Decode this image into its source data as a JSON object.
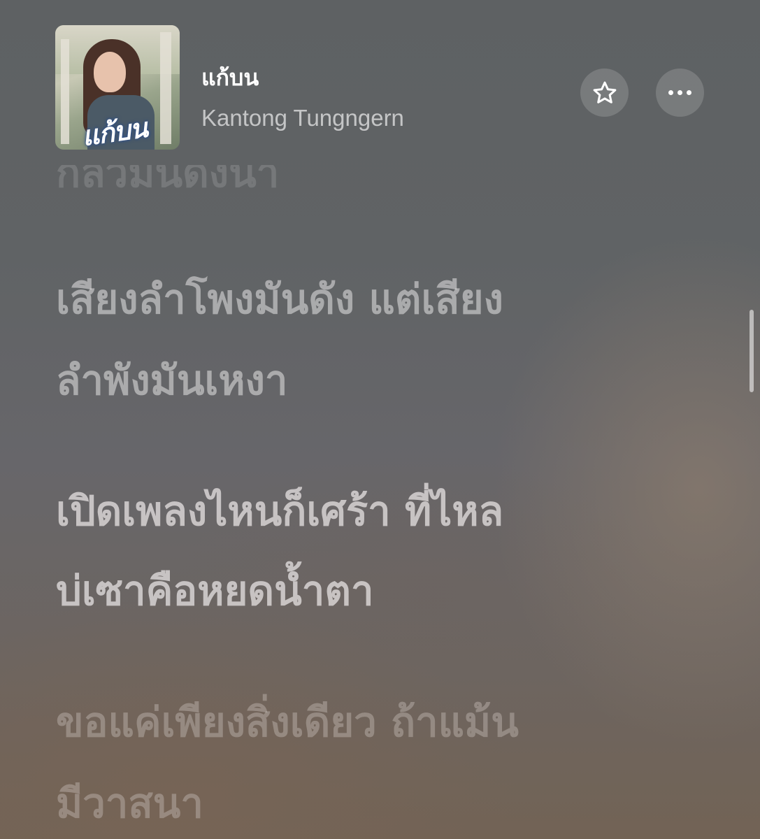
{
  "now_playing": {
    "title": "แก้บน",
    "artist": "Kantong Tungngern",
    "artwork_text": "แก้บน",
    "favorite_icon": "star-icon",
    "more_icon": "ellipsis-icon"
  },
  "lyrics": {
    "previous_line_partial": "กลัวมันดังนา",
    "lines": [
      {
        "a": "เสียงลำโพงมันดัง แต่เสียง",
        "b": "ลำพังมันเหงา"
      },
      {
        "a": "เปิดเพลงไหนก็เศร้า ที่ไหล",
        "b": "บ่เซาคือหยดน้ำตา"
      },
      {
        "a": "ขอแค่เพียงสิ่งเดียว ถ้าแม้น",
        "b": "มีวาสนา"
      }
    ]
  }
}
